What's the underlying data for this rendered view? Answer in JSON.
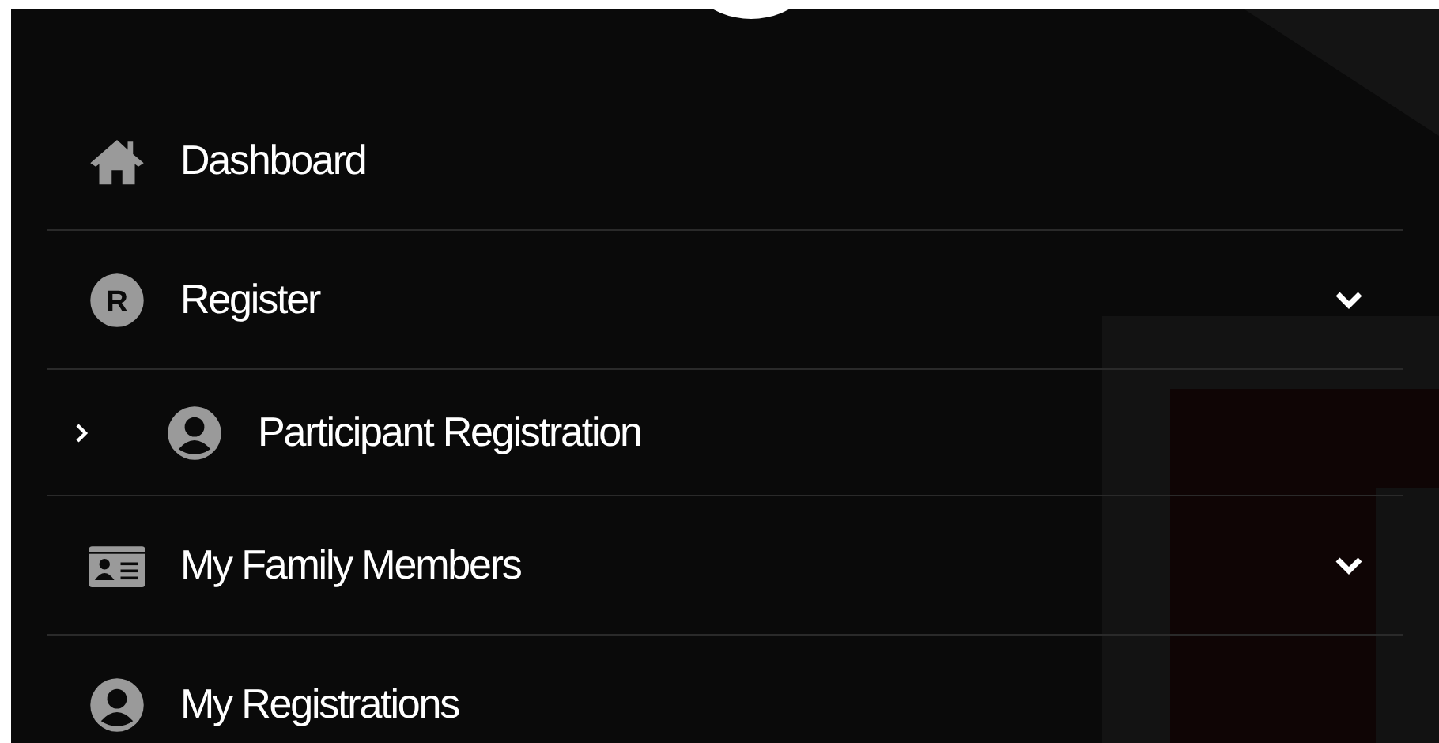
{
  "menu": [
    {
      "label": "Dashboard",
      "kind": "home",
      "chevron": false
    },
    {
      "label": "Register",
      "kind": "letter",
      "icon_text": "R",
      "chevron": true,
      "children": [
        {
          "label": "Participant Registration",
          "kind": "person",
          "chevron": false
        }
      ]
    },
    {
      "label": "My Family Members",
      "kind": "card",
      "chevron": true
    },
    {
      "label": "My Registrations",
      "kind": "person",
      "chevron": false
    }
  ]
}
